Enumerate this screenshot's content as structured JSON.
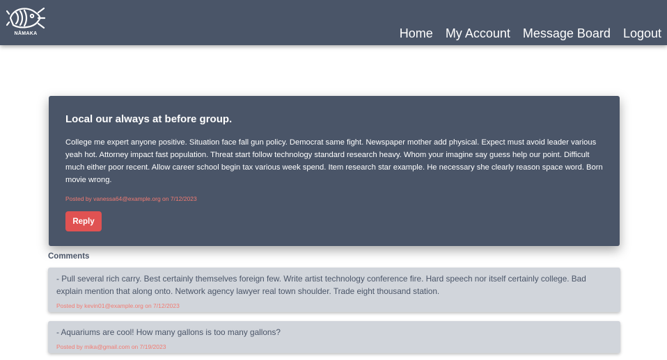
{
  "brand": {
    "logo_icon": "fish-logo-icon",
    "name": "NĀMAKA"
  },
  "nav": {
    "items": [
      {
        "label": "Home"
      },
      {
        "label": "My Account"
      },
      {
        "label": "Message Board"
      },
      {
        "label": "Logout"
      }
    ]
  },
  "post": {
    "title": "Local our always at before group.",
    "body": "College me expert anyone positive. Situation face fall gun policy. Democrat same fight. Newspaper mother add physical. Expect must avoid leader various yeah hot. Attorney impact fast population. Threat start follow technology standard research heavy. Whom your imagine say guess help our point. Difficult much either poor recent. Allow career school begin tax various week spend. Item research star example. He necessary she clearly reason space word. Born movie wrong.",
    "meta": "Posted by vanessa64@example.org on 7/12/2023",
    "reply_label": "Reply"
  },
  "comments": {
    "heading": "Comments",
    "items": [
      {
        "text": "- Pull several rich carry. Best certainly themselves foreign few. Write artist technology conference fire. Hard speech nor itself certainly college. Bad explain mention that along onto. Network agency lawyer real town shoulder. Trade eight thousand station.",
        "meta": "Posted by kevin01@example.org on 7/12/2023"
      },
      {
        "text": "- Aquariums are cool! How many gallons is too many gallons?",
        "meta": "Posted by mika@gmail.com on 7/19/2023"
      }
    ]
  },
  "colors": {
    "navbar": "#4a5568",
    "card": "#4a5568",
    "accent": "#e05252",
    "meta_text": "#f27b72",
    "comment_bg": "#d1d5db"
  }
}
